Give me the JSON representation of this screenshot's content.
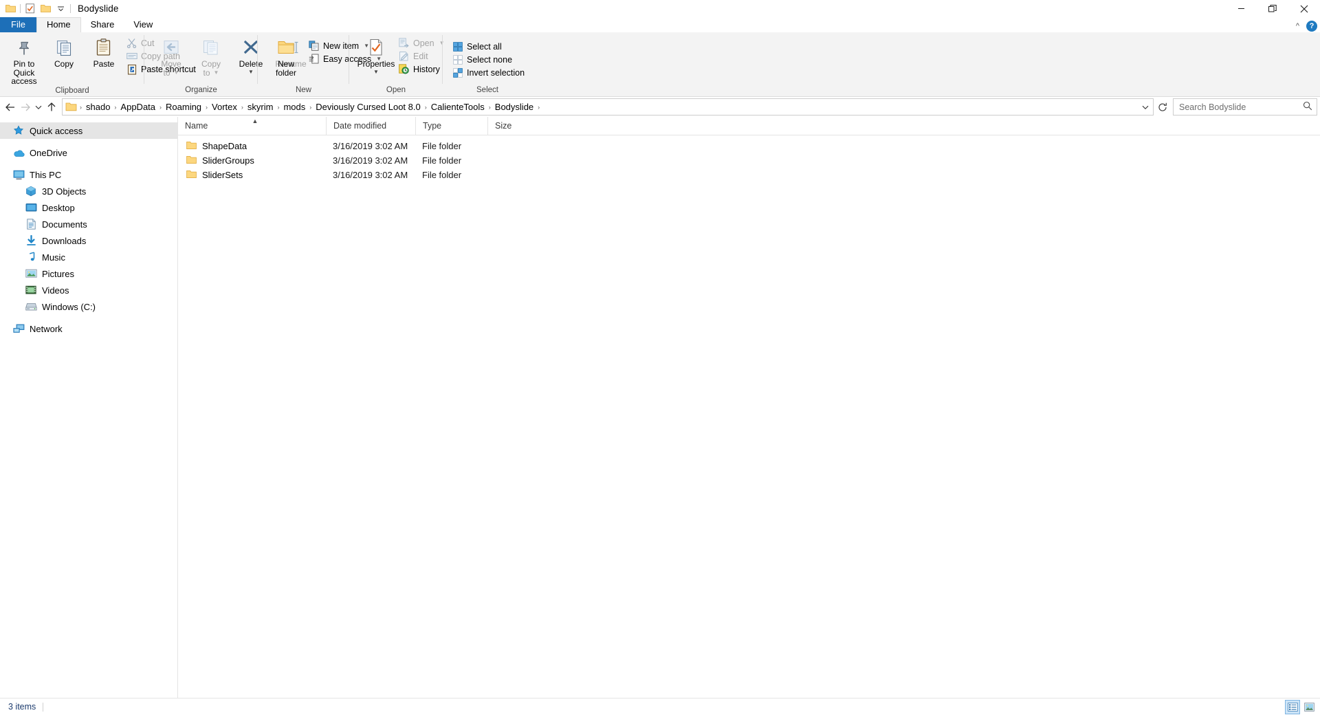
{
  "window": {
    "title": "Bodyslide",
    "quick_access_icons": [
      "folder-icon",
      "properties-check-icon",
      "new-folder-icon",
      "qat-dropdown-icon"
    ],
    "controls": {
      "minimize": "minimize-button",
      "maximize": "maximize-button",
      "close": "close-button"
    }
  },
  "tabs": [
    {
      "label": "File",
      "id": "file"
    },
    {
      "label": "Home",
      "id": "home"
    },
    {
      "label": "Share",
      "id": "share"
    },
    {
      "label": "View",
      "id": "view"
    }
  ],
  "ribbon": {
    "collapse_label": "^",
    "help_label": "?",
    "groups": [
      {
        "name": "Clipboard",
        "label": "Clipboard",
        "big": [
          {
            "label": "Pin to Quick\naccess",
            "line1": "Pin to Quick",
            "line2": "access",
            "icon": "pin-icon",
            "disabled": false
          },
          {
            "label": "Copy",
            "line1": "Copy",
            "line2": "",
            "icon": "copy-icon",
            "disabled": false
          },
          {
            "label": "Paste",
            "line1": "Paste",
            "line2": "",
            "icon": "paste-icon",
            "disabled": false
          }
        ],
        "small": [
          {
            "label": "Cut",
            "icon": "scissors-icon",
            "disabled": true
          },
          {
            "label": "Copy path",
            "icon": "copy-path-icon",
            "disabled": true
          },
          {
            "label": "Paste shortcut",
            "icon": "paste-shortcut-icon",
            "disabled": false
          }
        ]
      },
      {
        "name": "Organize",
        "label": "Organize",
        "big": [
          {
            "line1": "Move",
            "line2": "to",
            "icon": "move-to-icon",
            "disabled": true,
            "dropdown": true
          },
          {
            "line1": "Copy",
            "line2": "to",
            "icon": "copy-to-icon",
            "disabled": true,
            "dropdown": true
          },
          {
            "line1": "Delete",
            "line2": "",
            "icon": "delete-x-icon",
            "disabled": false,
            "dropdown": true
          },
          {
            "line1": "Rename",
            "line2": "",
            "icon": "rename-icon",
            "disabled": true,
            "dropdown": false
          }
        ]
      },
      {
        "name": "New",
        "label": "New",
        "big": [
          {
            "line1": "New",
            "line2": "folder",
            "icon": "new-folder-icon",
            "disabled": false
          }
        ],
        "small": [
          {
            "label": "New item",
            "icon": "new-item-icon",
            "disabled": false,
            "dropdown": true
          },
          {
            "label": "Easy access",
            "icon": "easy-access-icon",
            "disabled": false,
            "dropdown": true
          }
        ]
      },
      {
        "name": "Open",
        "label": "Open",
        "big": [
          {
            "line1": "Properties",
            "line2": "",
            "icon": "properties-icon",
            "disabled": false,
            "dropdown": true
          }
        ],
        "small": [
          {
            "label": "Open",
            "icon": "open-icon",
            "disabled": true,
            "dropdown": true
          },
          {
            "label": "Edit",
            "icon": "edit-icon",
            "disabled": true
          },
          {
            "label": "History",
            "icon": "history-icon",
            "disabled": false
          }
        ]
      },
      {
        "name": "Select",
        "label": "Select",
        "small": [
          {
            "label": "Select all",
            "icon": "select-all-icon",
            "disabled": false
          },
          {
            "label": "Select none",
            "icon": "select-none-icon",
            "disabled": false
          },
          {
            "label": "Invert selection",
            "icon": "invert-selection-icon",
            "disabled": false
          }
        ]
      }
    ]
  },
  "addressbar": {
    "back": "back-arrow-icon",
    "forward": "forward-arrow-icon",
    "recent": "recent-locations-icon",
    "up": "up-arrow-icon",
    "breadcrumbs": [
      "shado",
      "AppData",
      "Roaming",
      "Vortex",
      "skyrim",
      "mods",
      "Deviously Cursed Loot 8.0",
      "CalienteTools",
      "Bodyslide"
    ],
    "separator": "›",
    "dropdown_icon": "chevron-down-icon",
    "refresh_icon": "refresh-icon",
    "search": {
      "placeholder": "Search Bodyslide",
      "value": "",
      "icon": "search-icon"
    }
  },
  "navpane": {
    "groups": [
      {
        "items": [
          {
            "label": "Quick access",
            "icon": "star-pin-icon",
            "selected": true,
            "child": false
          }
        ]
      },
      {
        "items": [
          {
            "label": "OneDrive",
            "icon": "onedrive-cloud-icon",
            "selected": false,
            "child": false
          }
        ]
      },
      {
        "items": [
          {
            "label": "This PC",
            "icon": "this-pc-icon",
            "selected": false,
            "child": false
          },
          {
            "label": "3D Objects",
            "icon": "3d-objects-icon",
            "selected": false,
            "child": true
          },
          {
            "label": "Desktop",
            "icon": "desktop-icon",
            "selected": false,
            "child": true
          },
          {
            "label": "Documents",
            "icon": "documents-icon",
            "selected": false,
            "child": true
          },
          {
            "label": "Downloads",
            "icon": "downloads-icon",
            "selected": false,
            "child": true
          },
          {
            "label": "Music",
            "icon": "music-icon",
            "selected": false,
            "child": true
          },
          {
            "label": "Pictures",
            "icon": "pictures-icon",
            "selected": false,
            "child": true
          },
          {
            "label": "Videos",
            "icon": "videos-icon",
            "selected": false,
            "child": true
          },
          {
            "label": "Windows (C:)",
            "icon": "drive-icon",
            "selected": false,
            "child": true
          }
        ]
      },
      {
        "items": [
          {
            "label": "Network",
            "icon": "network-icon",
            "selected": false,
            "child": false
          }
        ]
      }
    ]
  },
  "filelist": {
    "columns": [
      {
        "label": "Name",
        "key": "name",
        "sorted": true,
        "sort_dir": "asc"
      },
      {
        "label": "Date modified",
        "key": "date",
        "sorted": false
      },
      {
        "label": "Type",
        "key": "type",
        "sorted": false
      },
      {
        "label": "Size",
        "key": "size",
        "sorted": false
      }
    ],
    "rows": [
      {
        "name": "ShapeData",
        "date": "3/16/2019 3:02 AM",
        "type": "File folder",
        "size": "",
        "icon": "folder-icon"
      },
      {
        "name": "SliderGroups",
        "date": "3/16/2019 3:02 AM",
        "type": "File folder",
        "size": "",
        "icon": "folder-icon"
      },
      {
        "name": "SliderSets",
        "date": "3/16/2019 3:02 AM",
        "type": "File folder",
        "size": "",
        "icon": "folder-icon"
      }
    ]
  },
  "statusbar": {
    "item_count": "3 items",
    "views": [
      {
        "name": "details-view-button",
        "icon": "details-view-icon",
        "active": true
      },
      {
        "name": "large-icons-view-button",
        "icon": "large-icons-view-icon",
        "active": false
      }
    ]
  },
  "colors": {
    "accent": "#1d6fb8",
    "ribbon_bg": "#f3f3f3",
    "folder": "#fcd77f",
    "selection": "#e5e5e5",
    "status_text": "#1d3c6e"
  }
}
